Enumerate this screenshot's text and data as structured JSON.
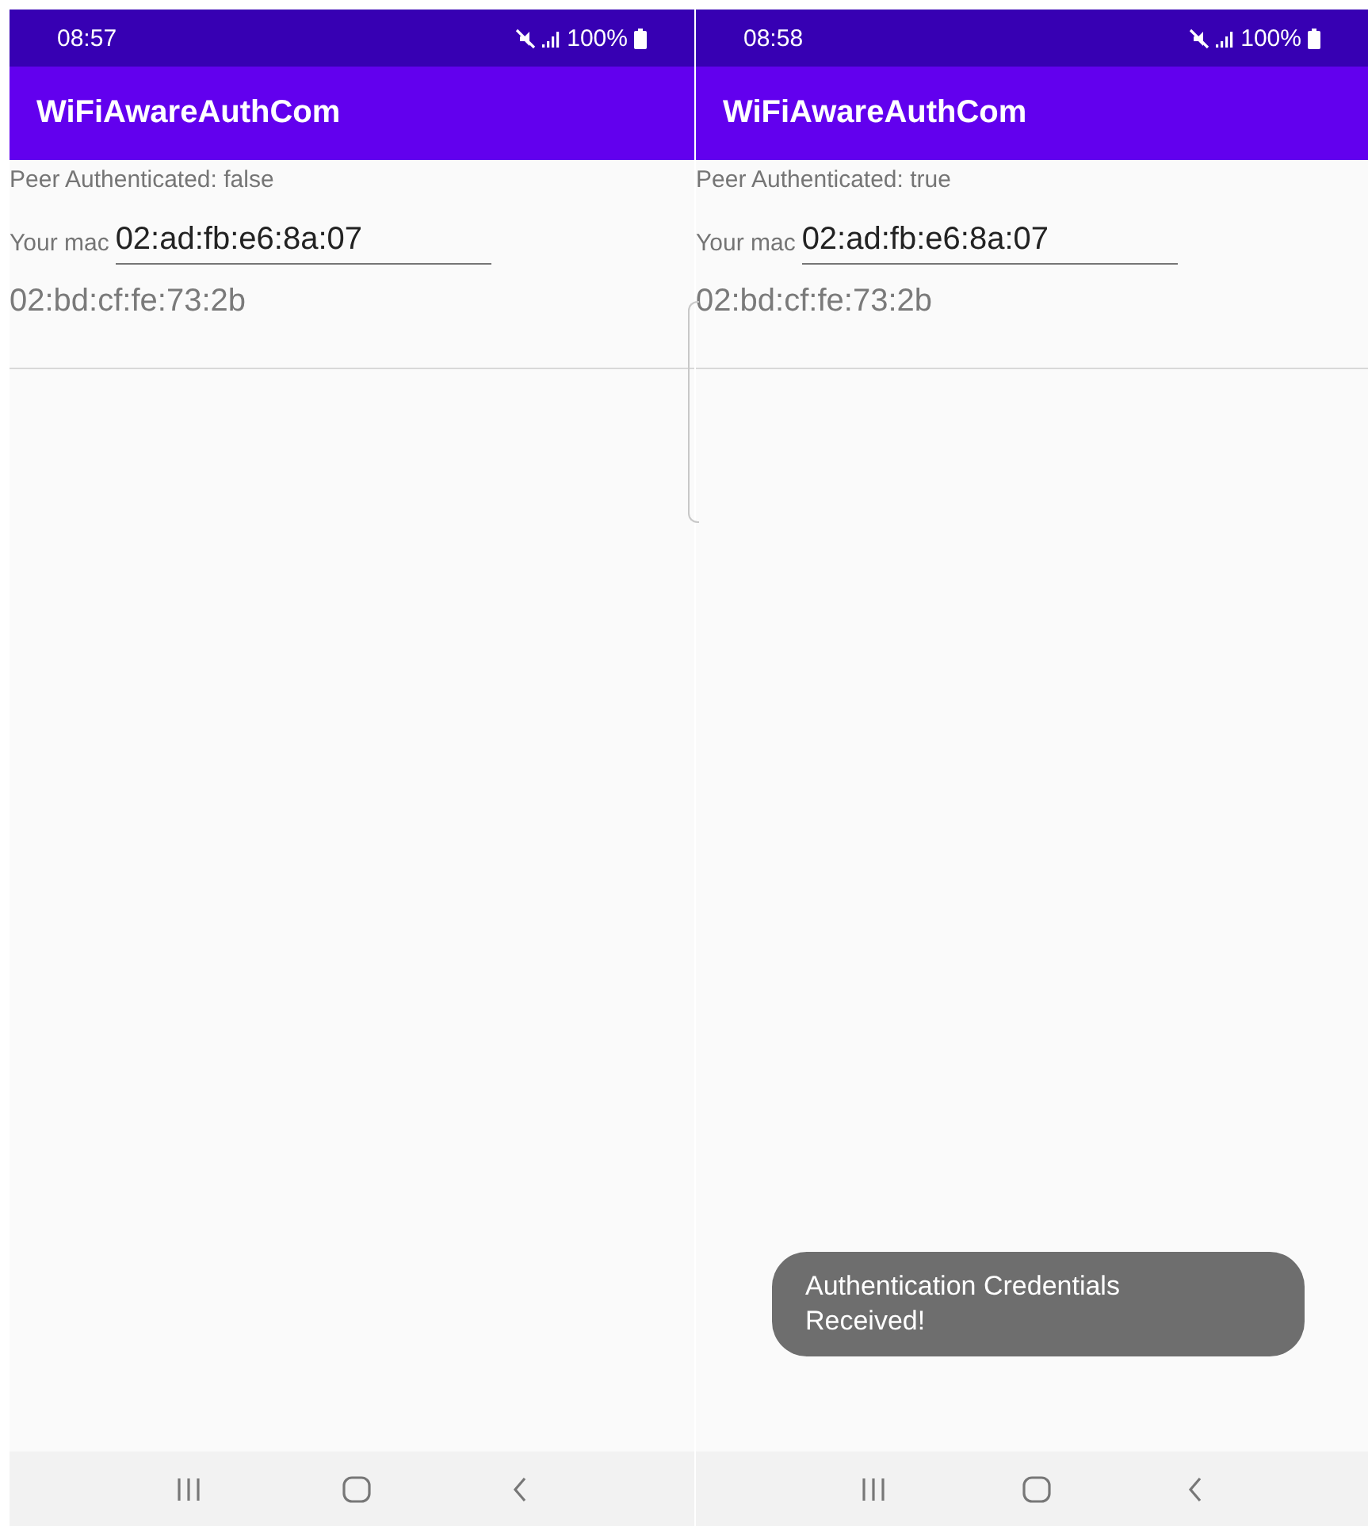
{
  "screens": [
    {
      "status_bar": {
        "time": "08:57",
        "battery": "100%"
      },
      "app_bar": {
        "title": "WiFiAwareAuthCom"
      },
      "peer_status": "Peer Authenticated: false",
      "mac_label": "Your mac",
      "mac_value": "02:ad:fb:e6:8a:07",
      "peer_mac": "02:bd:cf:fe:73:2b",
      "edge_handle": false
    },
    {
      "status_bar": {
        "time": "08:58",
        "battery": "100%"
      },
      "app_bar": {
        "title": "WiFiAwareAuthCom"
      },
      "peer_status": "Peer Authenticated: true",
      "mac_label": "Your mac",
      "mac_value": "02:ad:fb:e6:8a:07",
      "peer_mac": "02:bd:cf:fe:73:2b",
      "edge_handle": true,
      "toast": "Authentication Credentials Received!"
    }
  ]
}
